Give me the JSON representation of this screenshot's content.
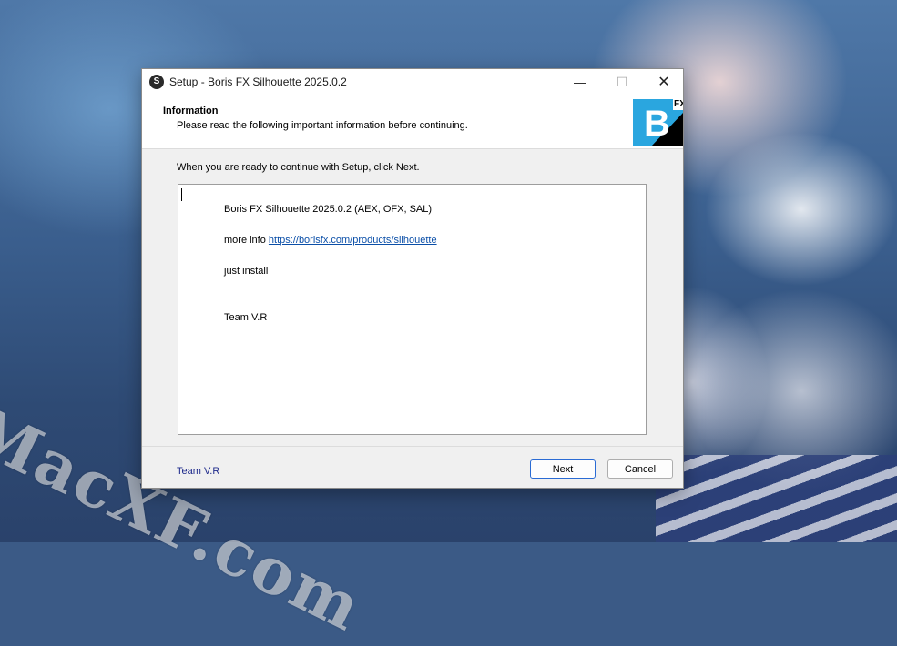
{
  "window": {
    "title": "Setup - Boris FX Silhouette 2025.0.2",
    "app_icon_glyph": "S",
    "min_glyph": "—",
    "max_glyph": "☐",
    "close_glyph": "✕"
  },
  "header": {
    "title": "Information",
    "subtitle": "Please read the following important information before continuing.",
    "logo_letter": "B",
    "logo_badge": "FX"
  },
  "body": {
    "intro": "When you are ready to continue with Setup, click Next.",
    "memo": {
      "line1": "Boris FX Silhouette 2025.0.2 (AEX, OFX, SAL)",
      "more_info_label": "more info ",
      "more_info_link": "https://borisfx.com/products/silhouette",
      "line3": "just install",
      "line4": "Team V.R"
    }
  },
  "footer": {
    "brand": "Team V.R",
    "next_label": "Next",
    "cancel_label": "Cancel"
  },
  "desktop": {
    "watermark": "MacXF.com"
  },
  "colors": {
    "accent": "#2a6bd4",
    "link": "#0b4fa8",
    "footer_brand": "#1f2b8c",
    "logo_bg": "#2aa6df"
  }
}
